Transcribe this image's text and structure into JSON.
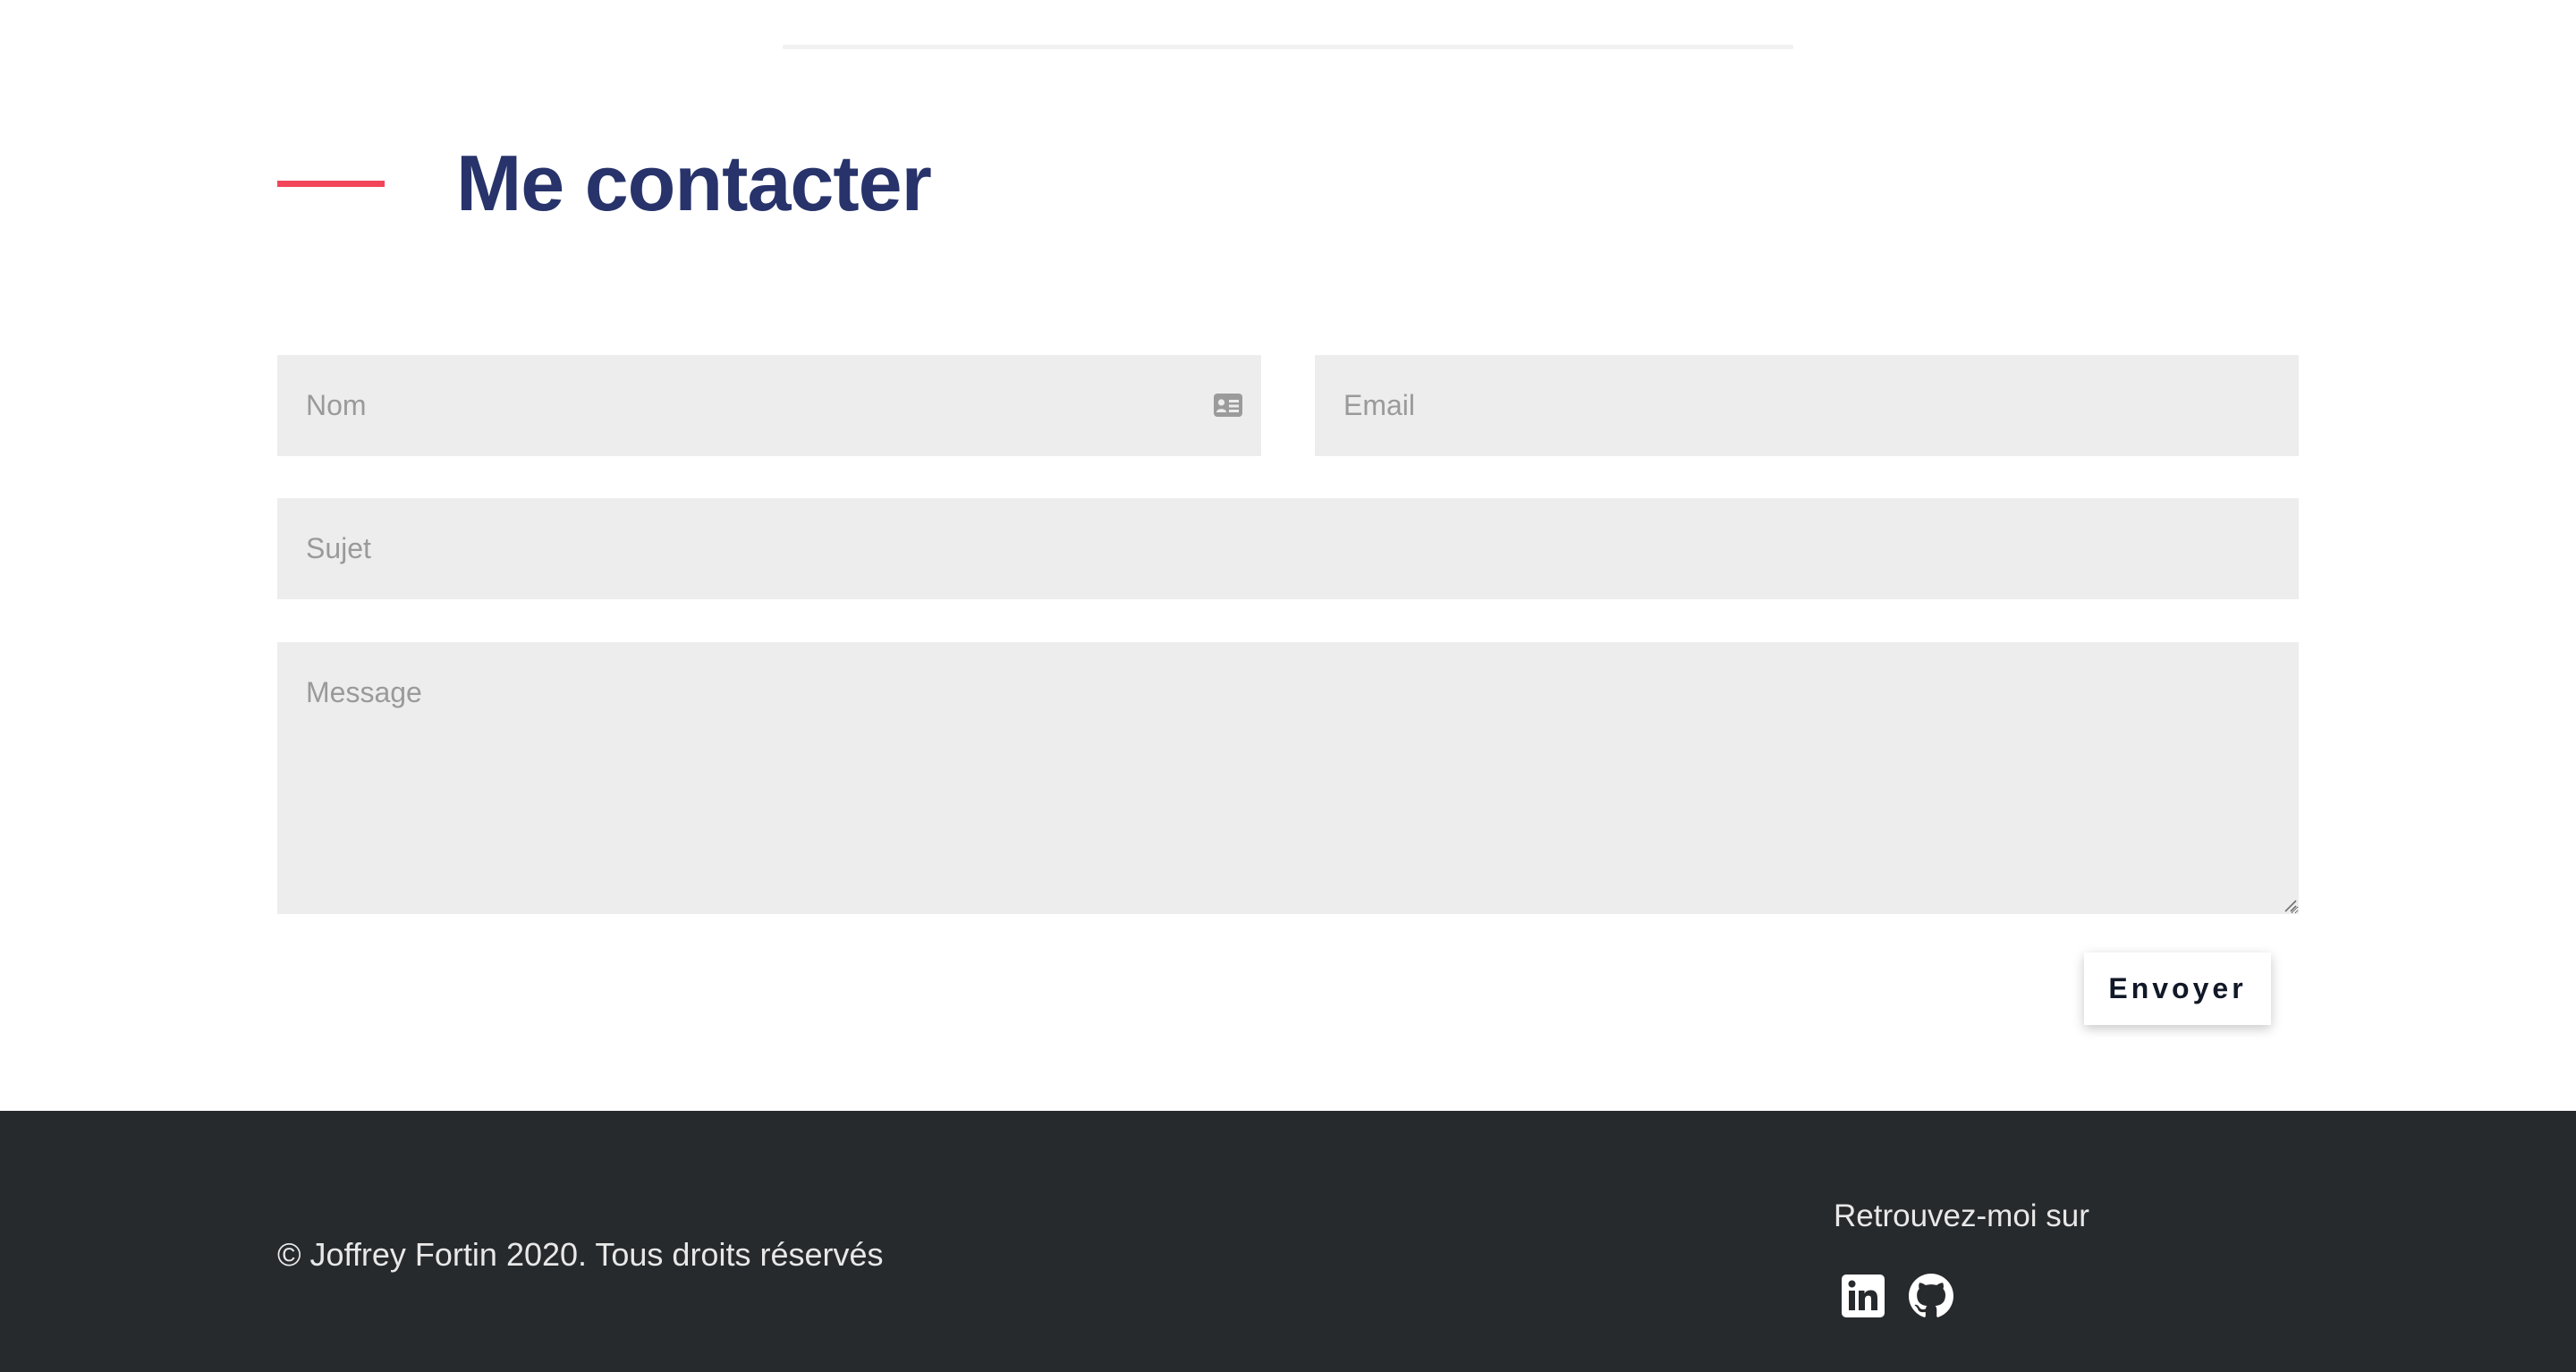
{
  "contact": {
    "title": "Me contacter",
    "fields": {
      "name_placeholder": "Nom",
      "email_placeholder": "Email",
      "subject_placeholder": "Sujet",
      "message_placeholder": "Message"
    },
    "send_label": "Envoyer"
  },
  "footer": {
    "copyright": "© Joffrey Fortin 2020. Tous droits réservés",
    "social_caption": "Retrouvez-moi sur",
    "social_links": [
      {
        "icon": "linkedin-icon"
      },
      {
        "icon": "github-icon"
      }
    ]
  },
  "colors": {
    "accent": "#f2455a",
    "heading": "#27336a",
    "field_background": "#ededed",
    "footer_background": "#272a2d"
  }
}
